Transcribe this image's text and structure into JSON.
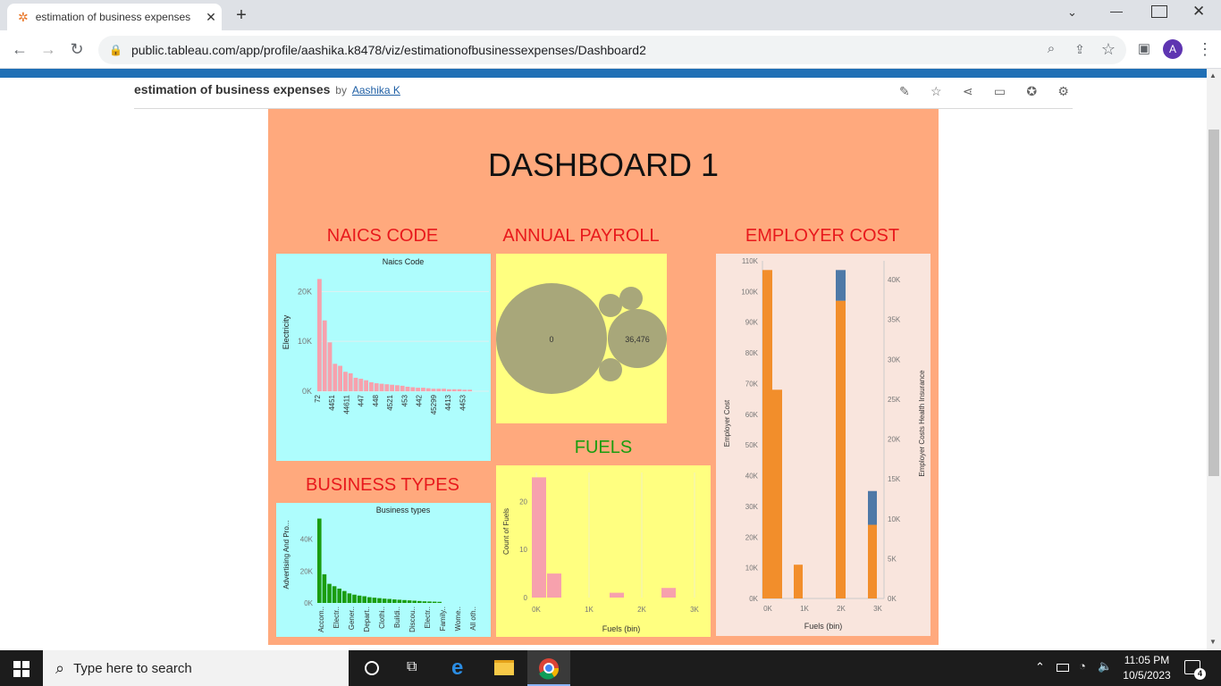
{
  "browser": {
    "tab_title": "estimation of business expenses",
    "url": "public.tableau.com/app/profile/aashika.k8478/viz/estimationofbusinessexpenses/Dashboard2",
    "profile_initial": "A"
  },
  "viz_header": {
    "title": "estimation of business expenses",
    "by": "by",
    "author": "Aashika K"
  },
  "dashboard": {
    "title": "DASHBOARD 1",
    "naics_title": "NAICS CODE",
    "payroll_title": "ANNUAL PAYROLL",
    "employer_title": "EMPLOYER COST",
    "business_title": "BUSINESS TYPES",
    "fuels_title": "FUELS"
  },
  "chart_data": [
    {
      "type": "bar",
      "title": "Naics Code",
      "ylabel": "Electricity",
      "ylim": [
        0,
        24000
      ],
      "yticks": [
        "0K",
        "10K",
        "20K"
      ],
      "categories": [
        "72",
        "",
        "4451",
        "",
        "44611",
        "",
        "447",
        "",
        "448",
        "",
        "4521",
        "",
        "453",
        "",
        "442",
        "",
        "45299",
        "",
        "4413",
        "",
        "4453"
      ],
      "values": [
        22500,
        14200,
        9800,
        5500,
        5100,
        3900,
        3600,
        2700,
        2500,
        2200,
        1800,
        1600,
        1500,
        1400,
        1300,
        1200,
        1100,
        900,
        800,
        700,
        700,
        600,
        500,
        500,
        500,
        400,
        400,
        400,
        300,
        300
      ],
      "bar_color": "#f7a1ad"
    },
    {
      "type": "scatter",
      "title": "ANNUAL PAYROLL",
      "labels": [
        "0",
        "36,476"
      ],
      "bubble_color": "#a8a77a"
    },
    {
      "type": "bar",
      "title": "",
      "xlabel": "Fuels (bin)",
      "ylabel": "Employer Cost",
      "y2label": "Employer Costs Health Insurance",
      "yticks": [
        "0K",
        "10K",
        "20K",
        "30K",
        "40K",
        "50K",
        "60K",
        "70K",
        "80K",
        "90K",
        "100K",
        "110K"
      ],
      "y2ticks": [
        "0K",
        "5K",
        "10K",
        "15K",
        "20K",
        "25K",
        "30K",
        "35K",
        "40K"
      ],
      "xticks": [
        "0K",
        "1K",
        "2K",
        "3K"
      ],
      "ylim": [
        0,
        110000
      ],
      "series": [
        {
          "name": "Employer Cost",
          "color": "#f28e2b",
          "values": [
            107000,
            68000,
            11000,
            97000,
            24000
          ]
        },
        {
          "name": "Employer Costs Health Insurance",
          "color": "#4e79a7",
          "values": [
            0,
            0,
            0,
            10000,
            11000
          ]
        }
      ]
    },
    {
      "type": "bar",
      "title": "Business types",
      "ylabel": "Advertising And Pro...",
      "ylim": [
        0,
        55000
      ],
      "yticks": [
        "0K",
        "20K",
        "40K"
      ],
      "categories": [
        "Accom..",
        "Electr..",
        "Gener..",
        "Depart..",
        "Clothi..",
        "Buildi..",
        "Discou..",
        "Electr..",
        "Family..",
        "Wome..",
        "All oth.."
      ],
      "values": [
        53000,
        18000,
        12000,
        10500,
        9000,
        7500,
        6000,
        5200,
        4600,
        4200,
        3600,
        3300,
        3000,
        2700,
        2500,
        2200,
        2000,
        1800,
        1600,
        1400,
        1200,
        1000,
        900,
        800,
        700
      ],
      "bar_color": "#1a9d0f"
    },
    {
      "type": "bar",
      "title": "",
      "xlabel": "Fuels (bin)",
      "ylabel": "Count of Fuels",
      "yticks": [
        "0",
        "10",
        "20"
      ],
      "xticks": [
        "0K",
        "1K",
        "2K",
        "3K"
      ],
      "ylim": [
        0,
        26
      ],
      "values": [
        25,
        5,
        0,
        1,
        0,
        2,
        0,
        1
      ],
      "bar_color": "#f7a1ad"
    }
  ],
  "taskbar": {
    "search_placeholder": "Type here to search",
    "time": "11:05 PM",
    "date": "10/5/2023",
    "notifications": "4"
  }
}
